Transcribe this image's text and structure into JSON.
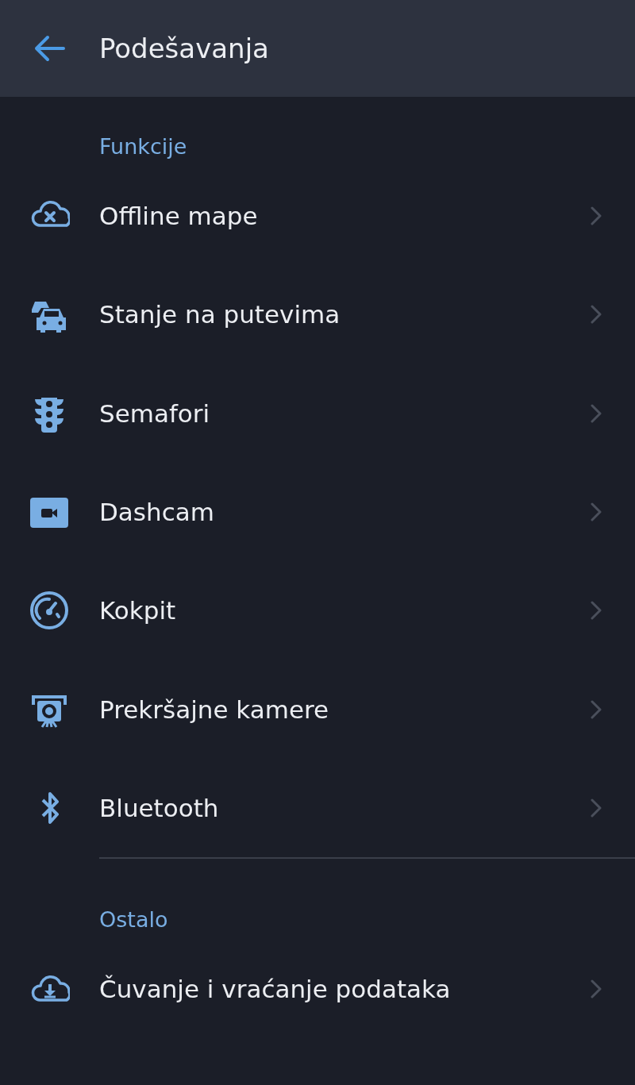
{
  "header": {
    "title": "Podešavanja"
  },
  "sections": [
    {
      "title": "Funkcije",
      "items": [
        {
          "label": "Offline mape"
        },
        {
          "label": "Stanje na putevima"
        },
        {
          "label": "Semafori"
        },
        {
          "label": "Dashcam"
        },
        {
          "label": "Kokpit"
        },
        {
          "label": "Prekršajne kamere"
        },
        {
          "label": "Bluetooth"
        }
      ]
    },
    {
      "title": "Ostalo",
      "items": [
        {
          "label": "Čuvanje i vraćanje podataka"
        }
      ]
    }
  ]
}
